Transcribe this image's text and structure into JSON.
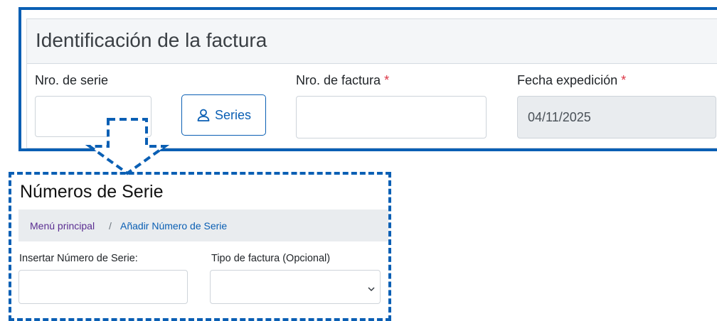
{
  "invoice_section": {
    "title": "Identificación de la factura",
    "serial_label": "Nro. de serie",
    "serial_value": "",
    "series_button_label": "Series",
    "invoice_number_label": "Nro. de factura",
    "invoice_number_value": "",
    "issue_date_label": "Fecha expedición",
    "issue_date_value": "04/11/2025",
    "required_marker": "*"
  },
  "serial_numbers_page": {
    "title": "Números de Serie",
    "breadcrumb": {
      "home": "Menú principal",
      "separator": "/",
      "current": "Añadir Número de Serie"
    },
    "insert_label": "Insertar Número de Serie:",
    "insert_value": "",
    "invoice_type_label": "Tipo de factura (Opcional)",
    "invoice_type_selected": ""
  },
  "icons": {
    "series_button": "user-icon",
    "select": "chevron-down-icon",
    "connector": "arrow-down-icon"
  },
  "colors": {
    "accent": "#0a5fb4",
    "required": "#dc3545",
    "breadcrumb_home": "#5a2d91",
    "readonly_bg": "#e9ecef"
  }
}
